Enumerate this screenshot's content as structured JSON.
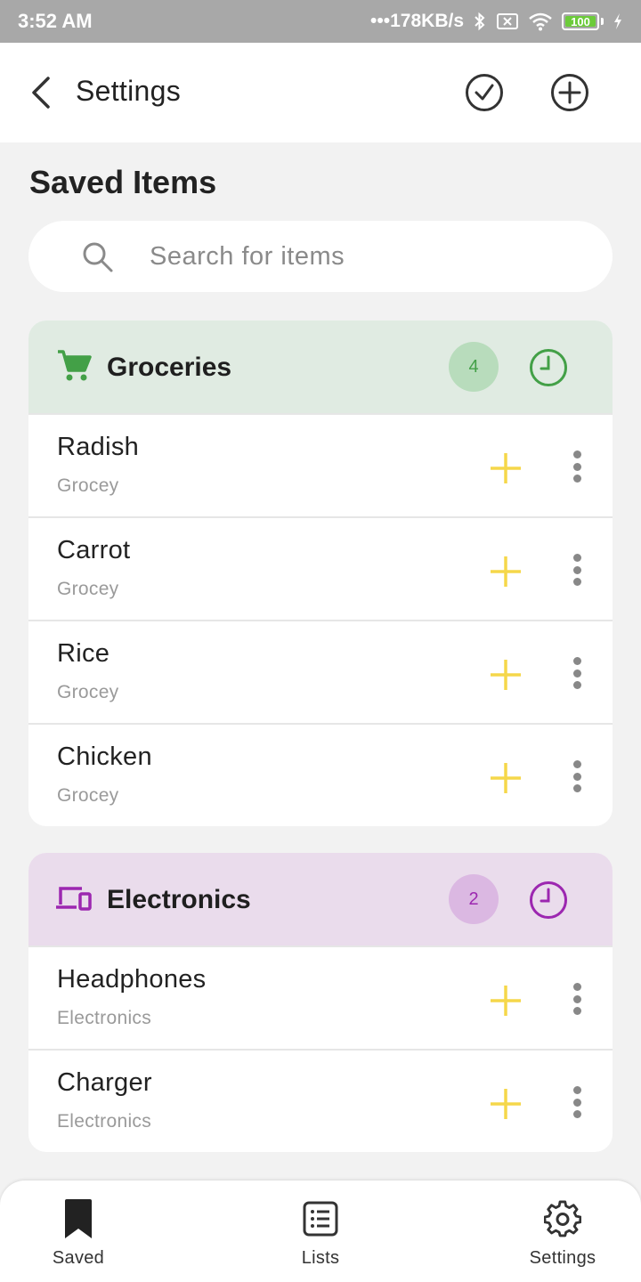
{
  "status": {
    "time": "3:52 AM",
    "speed": "178KB/s",
    "battery": "100"
  },
  "appbar": {
    "title": "Settings"
  },
  "page": {
    "section_title": "Saved Items"
  },
  "search": {
    "placeholder": "Search for items",
    "value": ""
  },
  "groups": [
    {
      "name": "Groceries",
      "count": "4",
      "items": [
        {
          "name": "Radish",
          "category": "Grocey"
        },
        {
          "name": "Carrot",
          "category": "Grocey"
        },
        {
          "name": "Rice",
          "category": "Grocey"
        },
        {
          "name": "Chicken",
          "category": "Grocey"
        }
      ]
    },
    {
      "name": "Electronics",
      "count": "2",
      "items": [
        {
          "name": "Headphones",
          "category": "Electronics"
        },
        {
          "name": "Charger",
          "category": "Electronics"
        }
      ]
    }
  ],
  "nav": {
    "saved": "Saved",
    "lists": "Lists",
    "settings": "Settings"
  },
  "colors": {
    "groceries_header": "#e0ebe2",
    "groceries_accent": "#43a047",
    "groceries_badge": "#b8dcbc",
    "electronics_header": "#eadcec",
    "electronics_accent": "#9c27b0",
    "electronics_badge": "#dbb8e2",
    "add_icon": "#f5d74a"
  },
  "icons": {
    "back": "arrow-back-icon",
    "check": "check-circle-icon",
    "add": "add-circle-icon",
    "search": "search-icon",
    "groceries": "shopping-cart-icon",
    "electronics": "devices-icon",
    "history": "clock-icon",
    "item_add": "plus-icon",
    "item_more": "more-vert-icon",
    "nav_saved": "bookmark-icon",
    "nav_lists": "list-icon",
    "nav_settings": "gear-icon"
  }
}
